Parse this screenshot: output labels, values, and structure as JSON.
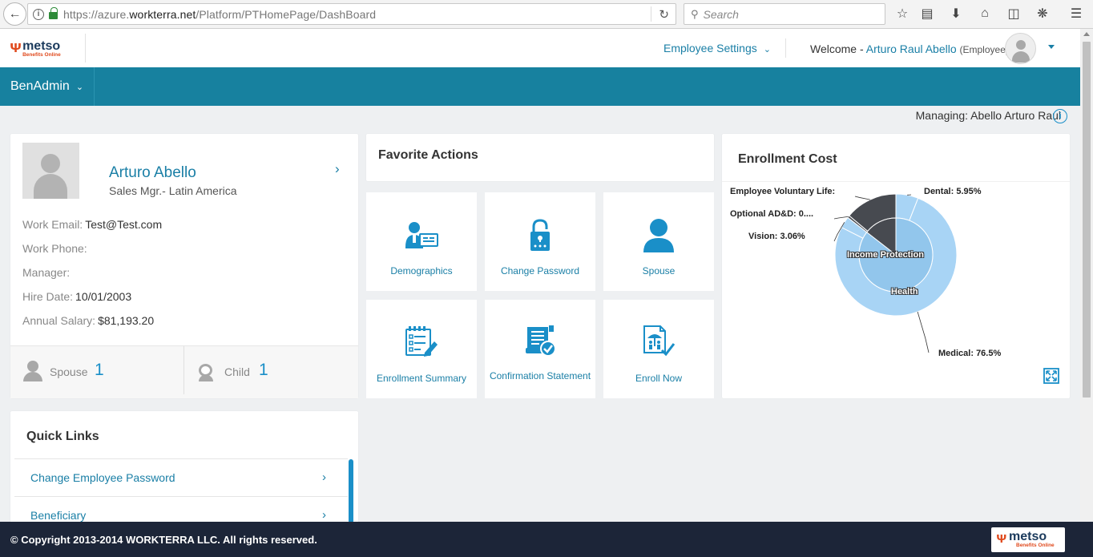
{
  "browser": {
    "url_prefix": "https://azure.",
    "url_host": "workterra.net",
    "url_path": "/Platform/PTHomePage/DashBoard",
    "search_placeholder": "Search"
  },
  "header": {
    "logo_brand": "metso",
    "logo_sub": "Benefits Online",
    "employee_settings": "Employee Settings",
    "welcome_prefix": "Welcome -",
    "user_name": "Arturo Raul Abello",
    "user_role": "(Employee)"
  },
  "nav": {
    "menu_label": "BenAdmin"
  },
  "managing": {
    "label": "Managing:",
    "name": "Abello Arturo Raul"
  },
  "profile": {
    "name": "Arturo Abello",
    "title": "Sales Mgr.- Latin America",
    "fields": [
      {
        "label": "Work Email:",
        "value": "Test@Test.com"
      },
      {
        "label": "Work Phone:",
        "value": ""
      },
      {
        "label": "Manager:",
        "value": ""
      },
      {
        "label": "Hire Date:",
        "value": "10/01/2003"
      },
      {
        "label": "Annual Salary:",
        "value": "$81,193.20"
      }
    ],
    "dependents": {
      "spouse_label": "Spouse",
      "spouse_count": "1",
      "child_label": "Child",
      "child_count": "1"
    }
  },
  "quick_links": {
    "title": "Quick Links",
    "items": [
      "Change Employee Password",
      "Beneficiary"
    ]
  },
  "favorites": {
    "title": "Favorite Actions",
    "tiles": [
      {
        "label": "Demographics",
        "icon": "id-card-person-icon"
      },
      {
        "label": "Change Password",
        "icon": "padlock-icon"
      },
      {
        "label": "Spouse",
        "icon": "person-icon"
      },
      {
        "label": "Enrollment Summary",
        "icon": "checklist-form-icon"
      },
      {
        "label": "Confirmation Statement",
        "icon": "document-check-icon"
      },
      {
        "label": "Enroll Now",
        "icon": "document-umbrella-check-icon"
      }
    ]
  },
  "enrollment_cost": {
    "title": "Enrollment Cost"
  },
  "chart_data": {
    "type": "pie",
    "title": "Enrollment Cost",
    "inner_ring": {
      "labels": [
        "Health",
        "Income Protection"
      ]
    },
    "outer_ring": {
      "slices": [
        {
          "label": "Dental",
          "display": "Dental: 5.95%",
          "value": 5.95
        },
        {
          "label": "Medical",
          "display": "Medical: 76.5%",
          "value": 76.5
        },
        {
          "label": "Vision",
          "display": "Vision: 3.06%",
          "value": 3.06
        },
        {
          "label": "Optional AD&D",
          "display": "Optional AD&D: 0....",
          "value": 0.6
        },
        {
          "label": "Employee Voluntary Life",
          "display": "Employee Voluntary Life:",
          "value": 13.89
        }
      ]
    },
    "colors": {
      "health": "#92c6ec",
      "health_outer": "#a8d4f5",
      "income_protection": "#474a50"
    }
  },
  "footer": {
    "copyright": "© Copyright 2013-2014 WORKTERRA LLC. All rights reserved.",
    "logo_brand": "metso",
    "logo_sub": "Benefits Online"
  }
}
